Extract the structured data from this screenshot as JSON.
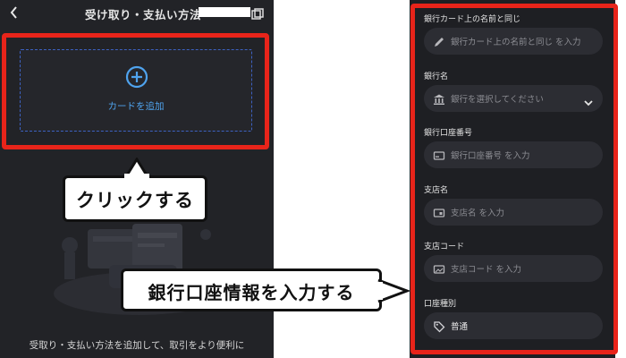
{
  "left": {
    "header": {
      "title": "受け取り・支払い方法"
    },
    "add_card": {
      "label": "カードを追加"
    },
    "callout": {
      "text": "クリックする"
    },
    "footer": {
      "text": "受取り・支払い方法を追加して、取引をより便利に"
    }
  },
  "right": {
    "fields": [
      {
        "label": "銀行カード上の名前と同じ",
        "placeholder": "銀行カード上の名前と同じ を入力",
        "icon": "pencil-icon"
      },
      {
        "label": "銀行名",
        "placeholder": "銀行を選択してください",
        "icon": "bank-icon"
      },
      {
        "label": "銀行口座番号",
        "placeholder": "銀行口座番号 を入力",
        "icon": "card-icon"
      },
      {
        "label": "支店名",
        "placeholder": "支店名 を入力",
        "icon": "branch-card-icon"
      },
      {
        "label": "支店コード",
        "placeholder": "支店コード を入力",
        "icon": "image-card-icon"
      },
      {
        "label": "口座種別",
        "value": "普通",
        "icon": "tag-icon"
      }
    ],
    "callout": {
      "text": "銀行口座情報を入力する"
    }
  },
  "colors": {
    "highlight": "#e8241a",
    "accent": "#4fa3ee",
    "dark_bg": "#222327"
  }
}
